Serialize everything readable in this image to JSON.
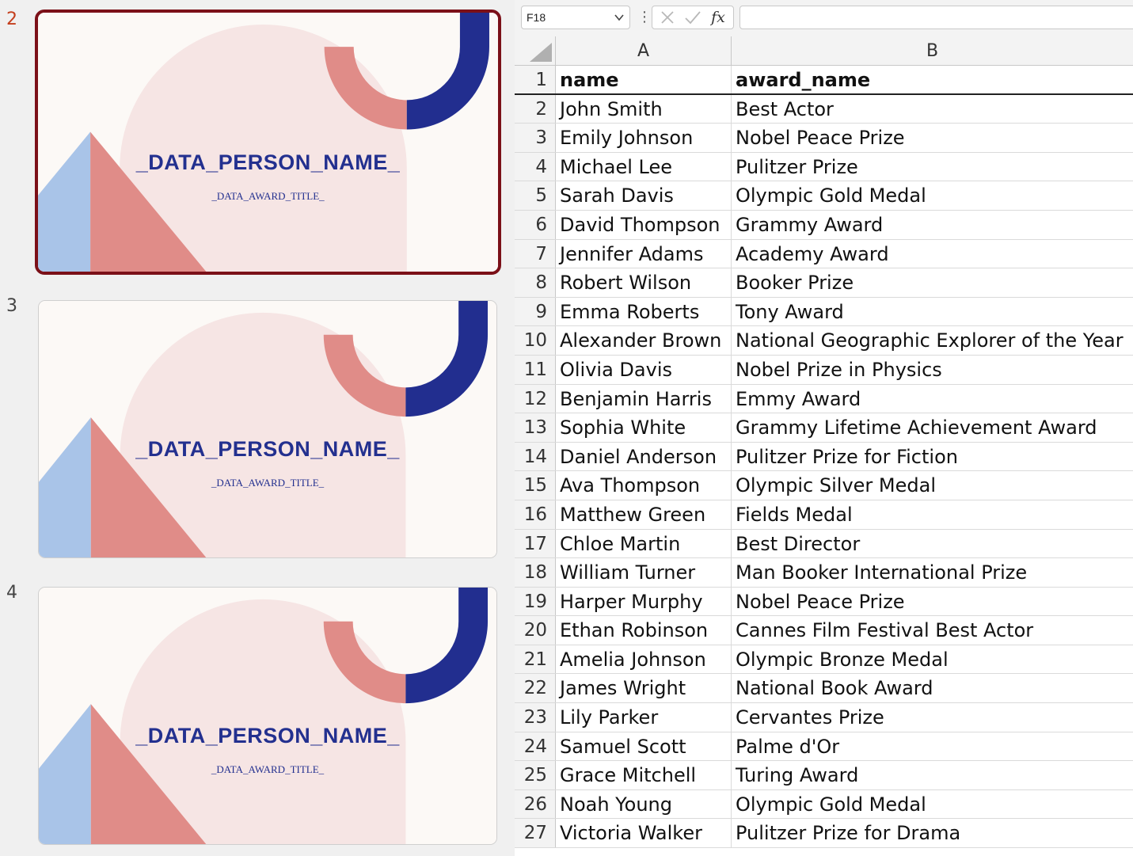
{
  "slides_pane": {
    "slides": [
      {
        "number": "2",
        "selected": true,
        "person_name": "_DATA_PERSON_NAME_",
        "award_title": "_DATA_AWARD_TITLE_"
      },
      {
        "number": "3",
        "selected": false,
        "person_name": "_DATA_PERSON_NAME_",
        "award_title": "_DATA_AWARD_TITLE_"
      },
      {
        "number": "4",
        "selected": false,
        "person_name": "_DATA_PERSON_NAME_",
        "award_title": "_DATA_AWARD_TITLE_"
      }
    ],
    "colors": {
      "slide_background": "#fcf9f6",
      "arch": "#f6e5e4",
      "salmon": "#e08c88",
      "navy": "#222e8f",
      "light_blue": "#a9c4e8",
      "selection_border": "#7b1018",
      "selected_number": "#c43e1c"
    }
  },
  "formula_bar": {
    "name_box": "F18",
    "name_box_icon": "chevron-down-icon",
    "cancel_icon": "cancel-x-icon",
    "enter_icon": "checkmark-icon",
    "function_label": "fx",
    "formula": ""
  },
  "sheet": {
    "columns": [
      "A",
      "B"
    ],
    "header": {
      "row_number": "1",
      "a": "name",
      "b": "award_name"
    },
    "rows": [
      {
        "n": "2",
        "a": "John Smith",
        "b": "Best Actor"
      },
      {
        "n": "3",
        "a": "Emily Johnson",
        "b": "Nobel Peace Prize"
      },
      {
        "n": "4",
        "a": "Michael Lee",
        "b": "Pulitzer Prize"
      },
      {
        "n": "5",
        "a": "Sarah Davis",
        "b": "Olympic Gold Medal"
      },
      {
        "n": "6",
        "a": "David Thompson",
        "b": "Grammy Award"
      },
      {
        "n": "7",
        "a": "Jennifer Adams",
        "b": "Academy Award"
      },
      {
        "n": "8",
        "a": "Robert Wilson",
        "b": "Booker Prize"
      },
      {
        "n": "9",
        "a": "Emma Roberts",
        "b": "Tony Award"
      },
      {
        "n": "10",
        "a": "Alexander Brown",
        "b": "National Geographic Explorer of the Year"
      },
      {
        "n": "11",
        "a": "Olivia Davis",
        "b": "Nobel Prize in Physics"
      },
      {
        "n": "12",
        "a": "Benjamin Harris",
        "b": "Emmy Award"
      },
      {
        "n": "13",
        "a": "Sophia White",
        "b": "Grammy Lifetime Achievement Award"
      },
      {
        "n": "14",
        "a": "Daniel Anderson",
        "b": "Pulitzer Prize for Fiction"
      },
      {
        "n": "15",
        "a": "Ava Thompson",
        "b": "Olympic Silver Medal"
      },
      {
        "n": "16",
        "a": "Matthew Green",
        "b": "Fields Medal"
      },
      {
        "n": "17",
        "a": "Chloe Martin",
        "b": "Best Director"
      },
      {
        "n": "18",
        "a": "William Turner",
        "b": "Man Booker International Prize"
      },
      {
        "n": "19",
        "a": "Harper Murphy",
        "b": "Nobel Peace Prize"
      },
      {
        "n": "20",
        "a": "Ethan Robinson",
        "b": "Cannes Film Festival Best Actor"
      },
      {
        "n": "21",
        "a": "Amelia Johnson",
        "b": "Olympic Bronze Medal"
      },
      {
        "n": "22",
        "a": "James Wright",
        "b": "National Book Award"
      },
      {
        "n": "23",
        "a": "Lily Parker",
        "b": "Cervantes Prize"
      },
      {
        "n": "24",
        "a": "Samuel Scott",
        "b": "Palme d'Or"
      },
      {
        "n": "25",
        "a": "Grace Mitchell",
        "b": "Turing Award"
      },
      {
        "n": "26",
        "a": "Noah Young",
        "b": "Olympic Gold Medal"
      },
      {
        "n": "27",
        "a": "Victoria Walker",
        "b": "Pulitzer Prize for Drama"
      }
    ]
  }
}
